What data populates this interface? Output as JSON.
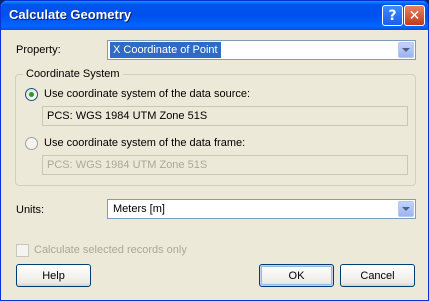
{
  "window": {
    "title": "Calculate Geometry",
    "help_button": "?",
    "close_button": "✕"
  },
  "property": {
    "label": "Property:",
    "value": "X Coordinate of Point"
  },
  "coordinate_system": {
    "group_title": "Coordinate System",
    "option_source": {
      "label": "Use coordinate system of the data source:",
      "value": "PCS: WGS 1984 UTM Zone 51S",
      "selected": true
    },
    "option_frame": {
      "label": "Use coordinate system of the data frame:",
      "value": "PCS: WGS 1984 UTM Zone 51S",
      "selected": false
    }
  },
  "units": {
    "label": "Units:",
    "value": "Meters [m]"
  },
  "selected_only": {
    "label": "Calculate selected records only",
    "checked": false,
    "enabled": false
  },
  "buttons": {
    "help": "Help",
    "ok": "OK",
    "cancel": "Cancel"
  }
}
